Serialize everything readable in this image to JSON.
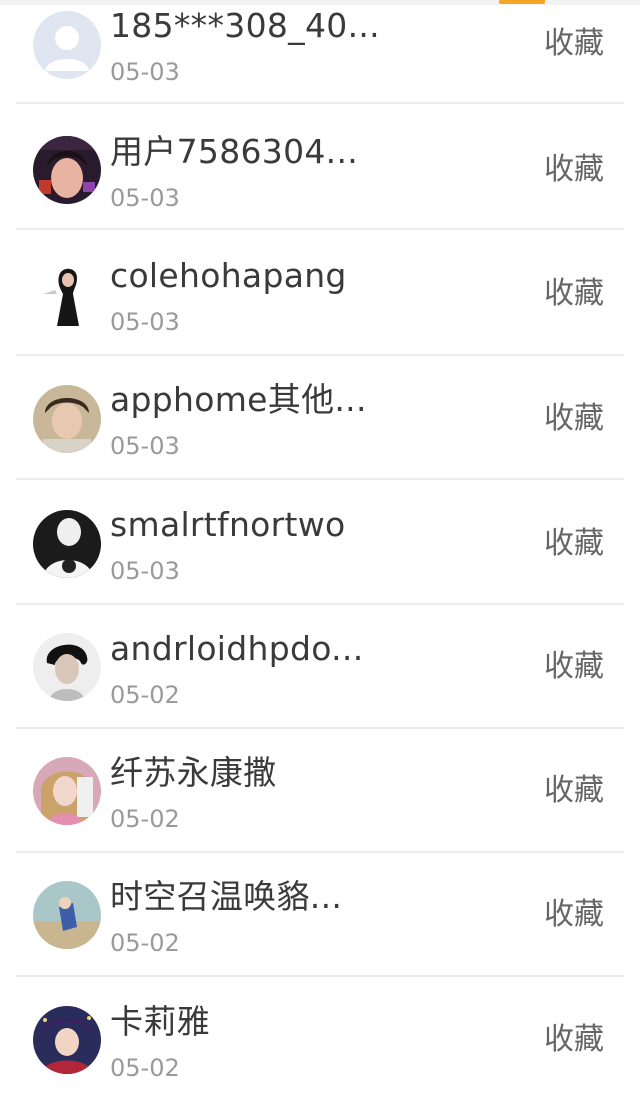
{
  "users": [
    {
      "name": "185***308_40...",
      "date": "05-03",
      "action": "收藏"
    },
    {
      "name": "用户7586304...",
      "date": "05-03",
      "action": "收藏"
    },
    {
      "name": "colehohapang",
      "date": "05-03",
      "action": "收藏"
    },
    {
      "name": "apphome其他...",
      "date": "05-03",
      "action": "收藏"
    },
    {
      "name": "smalrtfnortwo",
      "date": "05-03",
      "action": "收藏"
    },
    {
      "name": "andrloidhpdo...",
      "date": "05-02",
      "action": "收藏"
    },
    {
      "name": "纤苏永康撒",
      "date": "05-02",
      "action": "收藏"
    },
    {
      "name": "时空召温唤貉...",
      "date": "05-02",
      "action": "收藏"
    },
    {
      "name": "卡莉雅",
      "date": "05-02",
      "action": "收藏"
    }
  ],
  "colors": {
    "accent": "#f5a623",
    "name_text": "#3a3a3a",
    "date_text": "#9a9a9a",
    "action_text": "#666666",
    "divider": "#ececec"
  }
}
